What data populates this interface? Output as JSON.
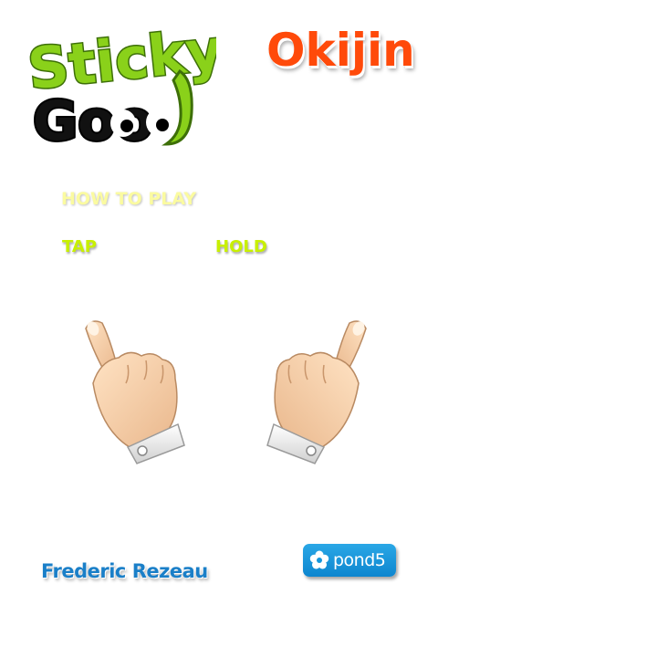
{
  "logo": {
    "word1": "Sticky",
    "word2": "Goo",
    "icon": "sticky-goo-logo"
  },
  "studio_name": "Okijin",
  "instructions": {
    "heading": "HOW TO PLAY",
    "tap_label": "TAP",
    "hold_label": "HOLD",
    "tap_icon": "pointing-hand-icon",
    "hold_icon": "pointing-hand-icon"
  },
  "credits": {
    "artist": "Frederic Rezeau",
    "sponsor": "pond5",
    "sponsor_icon": "flower-icon"
  },
  "colors": {
    "logo_green": "#8ad11a",
    "studio_orange": "#ff4a0a",
    "heading_yellow": "#fbfba0",
    "label_green": "#c8f000",
    "credit_blue": "#1a7fc8",
    "pond5_blue": "#1697dc"
  }
}
